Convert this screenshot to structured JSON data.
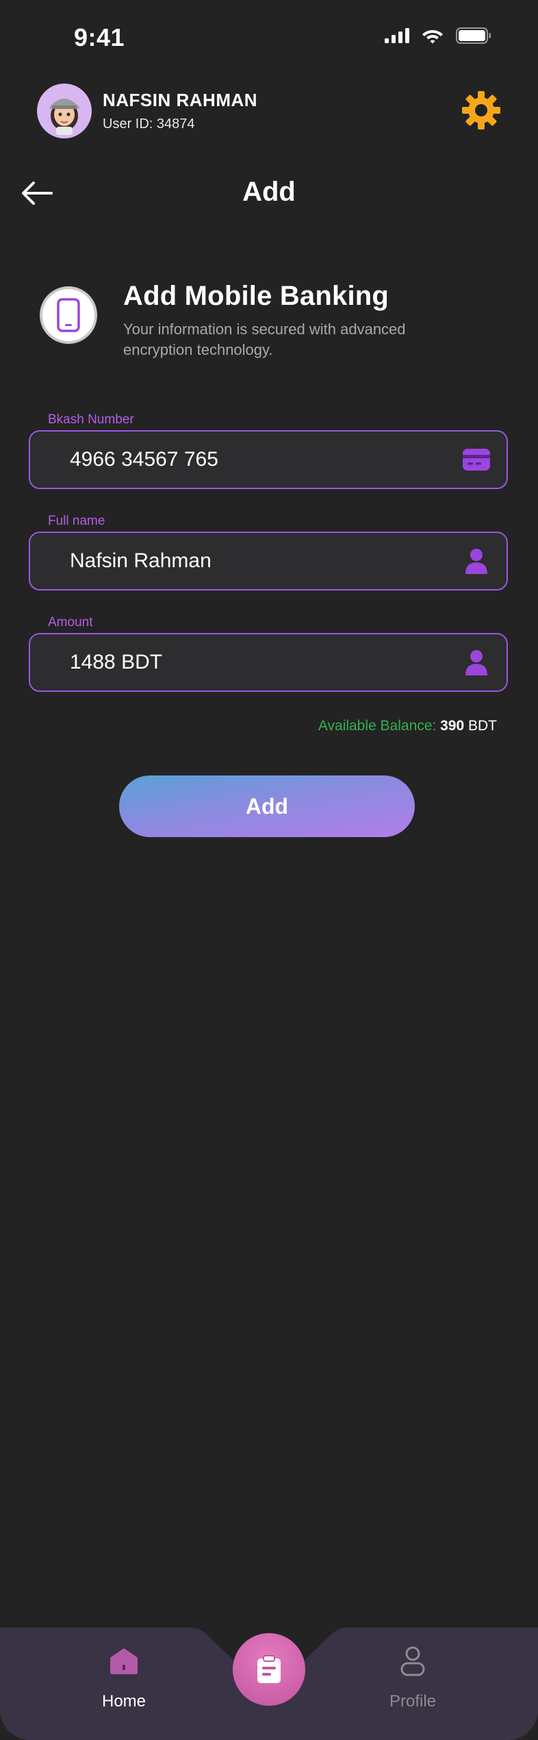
{
  "status_bar": {
    "time": "9:41"
  },
  "profile": {
    "name": "NAFSIN RAHMAN",
    "user_id": "User ID: 34874"
  },
  "header": {
    "title": "Add"
  },
  "info": {
    "title": "Add Mobile Banking",
    "subtitle": "Your information is secured with advanced encryption technology."
  },
  "form": {
    "fields": [
      {
        "label": "Bkash Number",
        "value": "4966 34567 765",
        "icon": "card-icon"
      },
      {
        "label": "Full name",
        "value": "Nafsin Rahman",
        "icon": "person-icon"
      },
      {
        "label": "Amount",
        "value": "1488 BDT",
        "icon": "person-icon"
      }
    ],
    "balance_label": "Available Balance:",
    "balance_value": "390",
    "balance_unit": "BDT",
    "submit_label": "Add"
  },
  "bottom_nav": {
    "items": [
      {
        "label": "Home",
        "icon": "home-icon",
        "active": true
      },
      {
        "label": "Profile",
        "icon": "user-outline-icon",
        "active": false
      }
    ],
    "center_icon": "clipboard-icon"
  },
  "colors": {
    "background": "#232323",
    "accent_purple": "#9a57e0",
    "label_purple": "#b45ee8",
    "settings_orange": "#f7a61c",
    "balance_green": "#33b24d",
    "nav_background": "#3a3245",
    "fab_pink": "#d166ae"
  }
}
